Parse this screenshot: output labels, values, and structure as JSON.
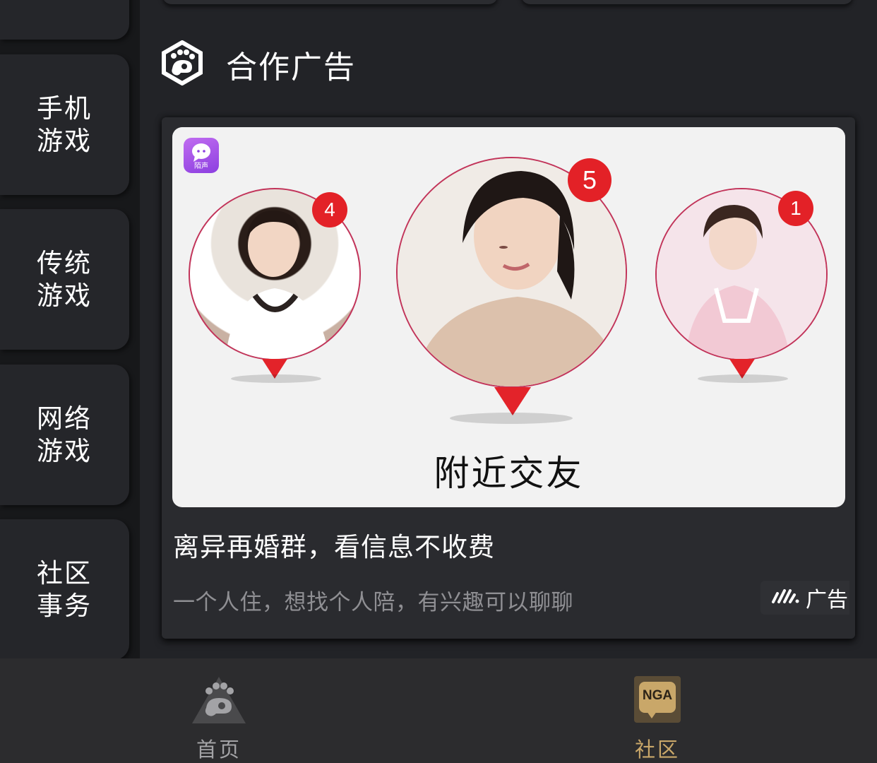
{
  "sidebar": {
    "items": [
      {
        "label": "手机游戏"
      },
      {
        "label": "传统游戏"
      },
      {
        "label": "网络游戏"
      },
      {
        "label": "社区事务"
      }
    ]
  },
  "section": {
    "title": "合作广告"
  },
  "ad": {
    "app_name": "陌声",
    "image_caption": "附近交友",
    "avatar_counts": [
      "4",
      "5",
      "1"
    ],
    "title": "离异再婚群，看信息不收费",
    "description": "一个人住，想找个人陪，有兴趣可以聊聊",
    "badge_label": "广告"
  },
  "bottom_nav": {
    "home_label": "首页",
    "community_label": "社区",
    "community_icon_text": "NGA",
    "active_color": "#c9a769",
    "inactive_color": "#a3a3a6"
  }
}
